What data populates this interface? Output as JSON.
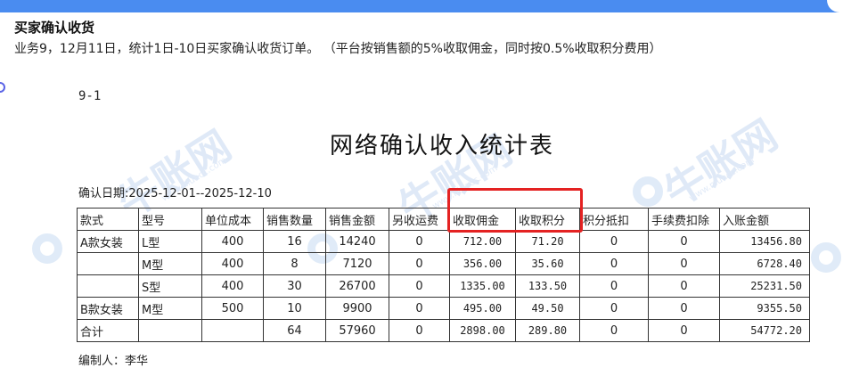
{
  "header": {
    "heading": "买家确认收货",
    "description": "业务9，12月11日，统计1日-10日买家确认收货订单。 （平台按销售额的5%收取佣金，同时按0.5%收取积分费用）"
  },
  "document": {
    "code": "9-1",
    "title": "网络确认收入统计表",
    "confirm_date": "确认日期:2025-12-01--2025-12-10",
    "editor": "编制人：李华"
  },
  "table": {
    "columns": [
      "款式",
      "型号",
      "单位成本",
      "销售数量",
      "销售金额",
      "另收运费",
      "收取佣金",
      "收取积分",
      "积分抵扣",
      "手续费扣除",
      "入账金额"
    ],
    "rows": [
      [
        "A款女装",
        "L型",
        "400",
        "16",
        "14240",
        "0",
        "712.00",
        "71.20",
        "0",
        "0",
        "13456.80"
      ],
      [
        "",
        "M型",
        "400",
        "8",
        "7120",
        "0",
        "356.00",
        "35.60",
        "0",
        "0",
        "6728.40"
      ],
      [
        "",
        "S型",
        "400",
        "30",
        "26700",
        "0",
        "1335.00",
        "133.50",
        "0",
        "0",
        "25231.50"
      ],
      [
        "B款女装",
        "M型",
        "500",
        "10",
        "9900",
        "0",
        "495.00",
        "49.50",
        "0",
        "0",
        "9355.50"
      ],
      [
        "合计",
        "",
        "",
        "64",
        "57960",
        "0",
        "2898.00",
        "289.80",
        "0",
        "0",
        "54772.20"
      ]
    ]
  },
  "watermark": {
    "brand": "牛账网",
    "url": "www.niuacc.com"
  },
  "colors": {
    "top_bar": "#4a8cf0",
    "highlight_box": "#e42222",
    "watermark": "#dfe9f7"
  }
}
